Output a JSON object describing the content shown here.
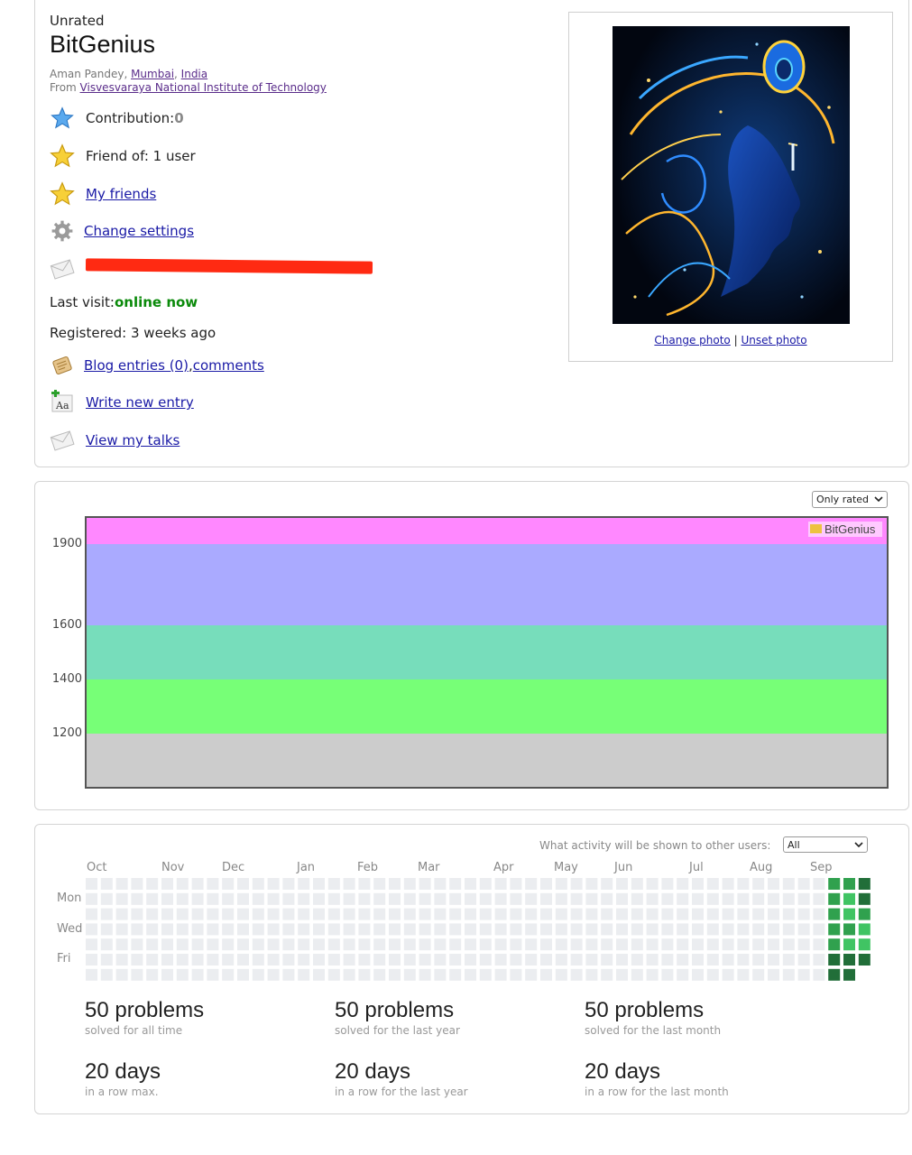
{
  "profile": {
    "rank": "Unrated",
    "handle": "BitGenius",
    "name": "Aman Pandey",
    "sep1": ", ",
    "city": "Mumbai",
    "sep2": ", ",
    "country": "India",
    "from_label": "From ",
    "organization": "Visvesvaraya National Institute of Technology",
    "contribution_label": "Contribution: ",
    "contribution_value": "0",
    "friend_of": "Friend of: 1 user",
    "my_friends": "My friends",
    "change_settings": "Change settings",
    "email_leading": "a",
    "last_visit_label": "Last visit: ",
    "last_visit_value": "online now",
    "registered": "Registered: 3 weeks ago",
    "blog_entries": "Blog entries (0)",
    "blog_sep": ", ",
    "comments": "comments",
    "write_new_entry": "Write new entry",
    "view_my_talks": "View my talks",
    "change_photo": "Change photo",
    "photo_sep": " | ",
    "unset_photo": "Unset photo"
  },
  "rating": {
    "filter_selected": "Only rated",
    "legend_label": "BitGenius",
    "legend_color": "#edc240",
    "y_ticks": [
      "1900",
      "1600",
      "1400",
      "1200"
    ]
  },
  "chart_data": {
    "type": "line",
    "series": [
      {
        "name": "BitGenius",
        "values": []
      }
    ],
    "y_ticks": [
      1200,
      1400,
      1600,
      1900
    ],
    "ylim": [
      1000,
      2000
    ],
    "bands": [
      {
        "from": 1000,
        "to": 1200,
        "color": "#cccccc"
      },
      {
        "from": 1200,
        "to": 1400,
        "color": "#77ff77"
      },
      {
        "from": 1400,
        "to": 1600,
        "color": "#77ddbb"
      },
      {
        "from": 1600,
        "to": 1900,
        "color": "#aaaaff"
      },
      {
        "from": 1900,
        "to": 2000,
        "color": "#ff88ff"
      }
    ],
    "grid": false,
    "legend": "top-right"
  },
  "activity": {
    "visibility_label": "What activity will be shown to other users:",
    "visibility_selected": "All",
    "months": [
      "Oct",
      "Nov",
      "Dec",
      "Jan",
      "Feb",
      "Mar",
      "Apr",
      "May",
      "Jun",
      "Jul",
      "Aug",
      "Sep"
    ],
    "day_labels": [
      "Mon",
      "Wed",
      "Fri"
    ],
    "empty_color": "#ebedf0",
    "level_colors": [
      "#40c463",
      "#30a14e",
      "#216e39"
    ],
    "active_cells": [
      {
        "week": 49,
        "day": 0,
        "level": 1
      },
      {
        "week": 49,
        "day": 1,
        "level": 1
      },
      {
        "week": 49,
        "day": 2,
        "level": 1
      },
      {
        "week": 49,
        "day": 3,
        "level": 1
      },
      {
        "week": 49,
        "day": 4,
        "level": 1
      },
      {
        "week": 49,
        "day": 5,
        "level": 2
      },
      {
        "week": 49,
        "day": 6,
        "level": 3
      },
      {
        "week": 50,
        "day": 0,
        "level": 1
      },
      {
        "week": 50,
        "day": 1,
        "level": 0
      },
      {
        "week": 50,
        "day": 2,
        "level": 0
      },
      {
        "week": 50,
        "day": 3,
        "level": 1
      },
      {
        "week": 50,
        "day": 4,
        "level": 0
      },
      {
        "week": 50,
        "day": 5,
        "level": 2
      },
      {
        "week": 50,
        "day": 6,
        "level": 3
      },
      {
        "week": 51,
        "day": 0,
        "level": 3
      },
      {
        "week": 51,
        "day": 1,
        "level": 3
      },
      {
        "week": 51,
        "day": 2,
        "level": 1
      },
      {
        "week": 51,
        "day": 3,
        "level": 0
      },
      {
        "week": 51,
        "day": 4,
        "level": 0
      },
      {
        "week": 51,
        "day": 5,
        "level": 3
      }
    ],
    "stats": [
      {
        "big": "50 problems",
        "small": "solved for all time"
      },
      {
        "big": "50 problems",
        "small": "solved for the last year"
      },
      {
        "big": "50 problems",
        "small": "solved for the last month"
      },
      {
        "big": "20 days",
        "small": "in a row max."
      },
      {
        "big": "20 days",
        "small": "in a row for the last year"
      },
      {
        "big": "20 days",
        "small": "in a row for the last month"
      }
    ]
  }
}
